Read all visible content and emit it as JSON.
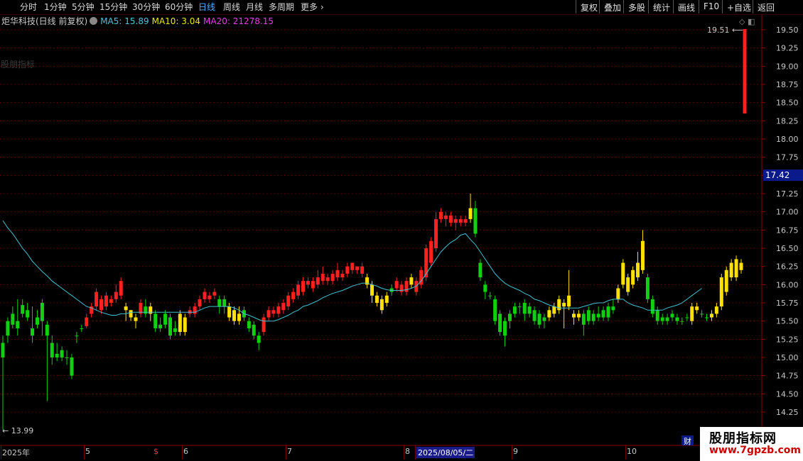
{
  "top_periods": [
    {
      "label": "分时",
      "active": false
    },
    {
      "label": "1分钟",
      "active": false
    },
    {
      "label": "5分钟",
      "active": false
    },
    {
      "label": "15分钟",
      "active": false
    },
    {
      "label": "30分钟",
      "active": false
    },
    {
      "label": "60分钟",
      "active": false
    },
    {
      "label": "日线",
      "active": true
    },
    {
      "label": "周线",
      "active": false
    },
    {
      "label": "月线",
      "active": false
    },
    {
      "label": "多周期",
      "active": false
    },
    {
      "label": "更多",
      "active": false
    }
  ],
  "right_buttons": [
    "复权",
    "叠加",
    "多股",
    "统计",
    "画线",
    "F10",
    "+自选",
    "返回"
  ],
  "stock_title": "炬华科技(日线 前复权)",
  "ma_labels": [
    {
      "text": "MA5: 15.89",
      "color": "#4fc3d8"
    },
    {
      "text": "MA10: 3.04",
      "color": "#e8e800"
    },
    {
      "text": "MA20: 21278.15",
      "color": "#e040e0"
    }
  ],
  "watermark_small": "股朋指标",
  "price_labels": [
    "19.50",
    "19.25",
    "19.00",
    "18.75",
    "18.50",
    "18.25",
    "18.00",
    "17.75",
    "17.50",
    "17.25",
    "17.00",
    "16.75",
    "16.50",
    "16.25",
    "16.00",
    "15.75",
    "15.50",
    "15.25",
    "15.00",
    "14.75",
    "14.50",
    "14.25"
  ],
  "current_price": "17.42",
  "high_marker": "19.51",
  "low_marker": "13.99",
  "bottom_labels": [
    {
      "text": "2025年",
      "color": "#c8c8c8"
    },
    {
      "text": "5",
      "color": "#c8c8c8"
    },
    {
      "text": "$",
      "color": "#ff3030"
    },
    {
      "text": "6",
      "color": "#c8c8c8"
    },
    {
      "text": "7",
      "color": "#c8c8c8"
    },
    {
      "text": "8",
      "color": "#c8c8c8"
    },
    {
      "text": "2025/08/05/二",
      "color": "#ffffff"
    },
    {
      "text": "9",
      "color": "#c8c8c8"
    },
    {
      "text": "10",
      "color": "#c8c8c8"
    }
  ],
  "cai_icon": "财",
  "site_watermark": {
    "line1": "股朋指标网",
    "line2": "www.7gpzb.com"
  },
  "colors": {
    "up": "#ff2020",
    "down": "#10d010",
    "yellow": "#ffe000",
    "ma": "#40c0d0",
    "grid": "#5a0000",
    "axis": "#8b0000"
  },
  "chart_data": {
    "type": "candlestick",
    "ylim": [
      13.9,
      19.6
    ],
    "candles": [
      [
        15.2,
        15.0,
        15.3,
        14.9,
        "g"
      ],
      [
        15.5,
        15.3,
        15.55,
        15.2,
        "g"
      ],
      [
        15.6,
        15.45,
        15.7,
        15.4,
        "g"
      ],
      [
        15.5,
        15.4,
        15.8,
        15.3,
        "g"
      ],
      [
        15.72,
        15.6,
        15.8,
        15.55,
        "g"
      ],
      [
        15.65,
        15.55,
        15.75,
        15.5,
        "g"
      ],
      [
        15.4,
        15.3,
        15.7,
        15.2,
        "g"
      ],
      [
        15.55,
        15.45,
        15.65,
        15.4,
        "g"
      ],
      [
        15.75,
        15.5,
        15.8,
        15.3,
        "g"
      ],
      [
        15.45,
        15.3,
        15.5,
        14.4,
        "g"
      ],
      [
        15.2,
        15.0,
        15.3,
        14.9,
        "g"
      ],
      [
        15.05,
        15.0,
        15.2,
        14.95,
        "g"
      ],
      [
        15.1,
        15.0,
        15.15,
        14.95,
        "g"
      ],
      [
        15.0,
        15.0,
        15.1,
        14.9,
        "g"
      ],
      [
        15.0,
        14.75,
        15.05,
        14.7,
        "g"
      ],
      [
        15.3,
        15.3,
        15.35,
        15.2,
        "g"
      ],
      [
        15.4,
        15.4,
        15.45,
        15.35,
        "g"
      ],
      [
        15.43,
        15.55,
        15.6,
        15.4,
        "r"
      ],
      [
        15.6,
        15.7,
        15.75,
        15.55,
        "r"
      ],
      [
        15.7,
        15.9,
        15.95,
        15.65,
        "r"
      ],
      [
        15.65,
        15.8,
        15.85,
        15.6,
        "r"
      ],
      [
        15.7,
        15.85,
        15.9,
        15.65,
        "r"
      ],
      [
        15.75,
        15.8,
        15.85,
        15.7,
        "r"
      ],
      [
        15.8,
        15.9,
        16.0,
        15.75,
        "r"
      ],
      [
        15.85,
        16.05,
        16.1,
        15.8,
        "r"
      ],
      [
        15.7,
        15.65,
        15.75,
        15.5,
        "y"
      ],
      [
        15.65,
        15.55,
        15.65,
        15.5,
        "y"
      ],
      [
        15.55,
        15.5,
        15.6,
        15.4,
        "y"
      ],
      [
        15.6,
        15.75,
        15.8,
        15.55,
        "r"
      ],
      [
        15.7,
        15.6,
        15.8,
        15.55,
        "g"
      ],
      [
        15.7,
        15.6,
        15.75,
        15.5,
        "y"
      ],
      [
        15.6,
        15.4,
        15.65,
        15.35,
        "g"
      ],
      [
        15.45,
        15.4,
        15.55,
        15.35,
        "g"
      ],
      [
        15.6,
        15.45,
        15.65,
        15.4,
        "g"
      ],
      [
        15.55,
        15.3,
        15.6,
        15.25,
        "g"
      ],
      [
        15.4,
        15.35,
        15.5,
        15.3,
        "g"
      ],
      [
        15.6,
        15.35,
        15.65,
        15.3,
        "y"
      ],
      [
        15.55,
        15.35,
        15.6,
        15.3,
        "y"
      ],
      [
        15.6,
        15.65,
        15.7,
        15.55,
        "r"
      ],
      [
        15.6,
        15.7,
        15.75,
        15.55,
        "r"
      ],
      [
        15.7,
        15.8,
        15.85,
        15.65,
        "r"
      ],
      [
        15.8,
        15.9,
        15.95,
        15.75,
        "r"
      ],
      [
        15.8,
        15.85,
        15.9,
        15.75,
        "r"
      ],
      [
        15.85,
        15.9,
        15.95,
        15.8,
        "r"
      ],
      [
        15.8,
        15.7,
        15.85,
        15.6,
        "g"
      ],
      [
        15.8,
        15.7,
        15.85,
        15.6,
        "g"
      ],
      [
        15.7,
        15.55,
        15.75,
        15.5,
        "y"
      ],
      [
        15.65,
        15.5,
        15.7,
        15.45,
        "y"
      ],
      [
        15.6,
        15.5,
        15.7,
        15.45,
        "y"
      ],
      [
        15.65,
        15.55,
        15.7,
        15.5,
        "g"
      ],
      [
        15.5,
        15.4,
        15.55,
        15.35,
        "g"
      ],
      [
        15.45,
        15.3,
        15.5,
        15.25,
        "g"
      ],
      [
        15.3,
        15.2,
        15.35,
        15.1,
        "g"
      ],
      [
        15.35,
        15.55,
        15.6,
        15.3,
        "r"
      ],
      [
        15.55,
        15.65,
        15.7,
        15.5,
        "r"
      ],
      [
        15.6,
        15.65,
        15.7,
        15.55,
        "r"
      ],
      [
        15.6,
        15.7,
        15.75,
        15.55,
        "r"
      ],
      [
        15.65,
        15.75,
        15.8,
        15.6,
        "r"
      ],
      [
        15.7,
        15.85,
        15.9,
        15.65,
        "r"
      ],
      [
        15.8,
        15.9,
        15.95,
        15.75,
        "r"
      ],
      [
        15.85,
        16.0,
        16.05,
        15.8,
        "r"
      ],
      [
        15.9,
        16.05,
        16.1,
        15.85,
        "r"
      ],
      [
        16.0,
        16.05,
        16.1,
        15.95,
        "r"
      ],
      [
        15.95,
        16.05,
        16.1,
        15.9,
        "r"
      ],
      [
        16.0,
        16.1,
        16.2,
        15.95,
        "r"
      ],
      [
        16.05,
        16.15,
        16.25,
        16.0,
        "r"
      ],
      [
        16.05,
        16.1,
        16.15,
        16.0,
        "r"
      ],
      [
        16.05,
        16.15,
        16.2,
        16.0,
        "r"
      ],
      [
        16.1,
        16.2,
        16.3,
        16.05,
        "r"
      ],
      [
        16.1,
        16.15,
        16.2,
        16.05,
        "r"
      ],
      [
        16.15,
        16.25,
        16.3,
        16.1,
        "r"
      ],
      [
        16.2,
        16.3,
        16.3,
        16.15,
        "r"
      ],
      [
        16.25,
        16.2,
        16.25,
        16.15,
        "r"
      ],
      [
        16.15,
        16.25,
        16.3,
        16.1,
        "r"
      ],
      [
        16.1,
        16.0,
        16.15,
        15.95,
        "y"
      ],
      [
        16.0,
        15.85,
        16.05,
        15.75,
        "y"
      ],
      [
        15.85,
        15.75,
        15.9,
        15.7,
        "y"
      ],
      [
        15.8,
        15.65,
        15.85,
        15.6,
        "y"
      ],
      [
        15.75,
        15.85,
        15.9,
        15.7,
        "y"
      ],
      [
        15.9,
        15.95,
        16.0,
        15.85,
        "g"
      ],
      [
        15.95,
        16.05,
        16.1,
        15.9,
        "r"
      ],
      [
        16.0,
        15.9,
        16.05,
        15.85,
        "r"
      ],
      [
        15.9,
        16.05,
        16.1,
        15.85,
        "r"
      ],
      [
        16.0,
        16.1,
        16.15,
        15.95,
        "y"
      ],
      [
        16.05,
        15.9,
        16.1,
        15.85,
        "r"
      ],
      [
        16.0,
        16.2,
        16.25,
        15.95,
        "r"
      ],
      [
        16.1,
        16.5,
        16.55,
        16.05,
        "r"
      ],
      [
        16.3,
        16.6,
        16.65,
        16.25,
        "r"
      ],
      [
        16.5,
        16.9,
        17.0,
        16.45,
        "r"
      ],
      [
        16.9,
        17.0,
        17.05,
        16.85,
        "r"
      ],
      [
        16.95,
        16.9,
        17.0,
        16.8,
        "r"
      ],
      [
        16.85,
        16.95,
        17.0,
        16.8,
        "r"
      ],
      [
        16.9,
        16.85,
        16.95,
        16.75,
        "r"
      ],
      [
        16.85,
        16.9,
        16.95,
        16.8,
        "r"
      ],
      [
        16.9,
        16.85,
        16.95,
        16.8,
        "r"
      ],
      [
        16.9,
        17.05,
        17.25,
        16.85,
        "y"
      ],
      [
        17.05,
        16.7,
        17.15,
        16.65,
        "g"
      ],
      [
        16.3,
        16.1,
        16.35,
        16.05,
        "g"
      ],
      [
        16.0,
        15.9,
        16.05,
        15.8,
        "g"
      ],
      [
        15.85,
        15.85,
        15.9,
        15.8,
        "g"
      ],
      [
        15.8,
        15.5,
        15.85,
        15.45,
        "g"
      ],
      [
        15.6,
        15.35,
        15.65,
        15.3,
        "g"
      ],
      [
        15.5,
        15.3,
        15.55,
        15.15,
        "g"
      ],
      [
        15.6,
        15.5,
        15.65,
        15.4,
        "g"
      ],
      [
        15.6,
        15.7,
        15.75,
        15.55,
        "g"
      ],
      [
        15.7,
        15.7,
        15.75,
        15.6,
        "g"
      ],
      [
        15.75,
        15.6,
        15.8,
        15.5,
        "g"
      ],
      [
        15.7,
        15.6,
        15.75,
        15.55,
        "g"
      ],
      [
        15.65,
        15.5,
        15.7,
        15.45,
        "g"
      ],
      [
        15.6,
        15.45,
        15.65,
        15.4,
        "g"
      ],
      [
        15.55,
        15.5,
        15.6,
        15.4,
        "g"
      ],
      [
        15.55,
        15.65,
        15.7,
        15.5,
        "y"
      ],
      [
        15.7,
        15.6,
        15.75,
        15.55,
        "y"
      ],
      [
        15.65,
        15.8,
        15.85,
        15.6,
        "y"
      ],
      [
        15.75,
        15.7,
        15.8,
        15.4,
        "y"
      ],
      [
        15.7,
        15.85,
        16.2,
        15.65,
        "y"
      ],
      [
        15.6,
        15.55,
        15.65,
        15.45,
        "y"
      ],
      [
        15.55,
        15.6,
        15.65,
        15.5,
        "y"
      ],
      [
        15.6,
        15.45,
        15.65,
        15.3,
        "g"
      ],
      [
        15.5,
        15.65,
        15.7,
        15.45,
        "g"
      ],
      [
        15.6,
        15.5,
        15.65,
        15.45,
        "g"
      ],
      [
        15.55,
        15.6,
        15.7,
        15.5,
        "g"
      ],
      [
        15.65,
        15.55,
        15.7,
        15.5,
        "g"
      ],
      [
        15.55,
        15.7,
        15.75,
        15.5,
        "g"
      ],
      [
        15.7,
        15.65,
        15.8,
        15.6,
        "g"
      ],
      [
        15.8,
        15.95,
        16.0,
        15.75,
        "y"
      ],
      [
        16.0,
        16.3,
        16.35,
        15.95,
        "y"
      ],
      [
        15.9,
        16.1,
        16.15,
        15.85,
        "y"
      ],
      [
        16.0,
        16.2,
        16.25,
        15.95,
        "y"
      ],
      [
        16.1,
        16.3,
        16.45,
        16.05,
        "y"
      ],
      [
        16.2,
        16.6,
        16.75,
        16.15,
        "y"
      ],
      [
        16.1,
        15.8,
        16.15,
        15.75,
        "g"
      ],
      [
        15.8,
        15.6,
        15.85,
        15.55,
        "g"
      ],
      [
        15.65,
        15.5,
        15.7,
        15.45,
        "g"
      ],
      [
        15.5,
        15.55,
        15.6,
        15.45,
        "g"
      ],
      [
        15.55,
        15.5,
        15.6,
        15.45,
        "g"
      ],
      [
        15.55,
        15.6,
        15.65,
        15.5,
        "g"
      ],
      [
        15.55,
        15.5,
        15.6,
        15.45,
        "g"
      ],
      [
        15.5,
        15.5,
        15.55,
        15.45,
        "g"
      ],
      [
        15.55,
        15.55,
        15.6,
        15.5,
        "g"
      ],
      [
        15.5,
        15.7,
        15.75,
        15.45,
        "y"
      ],
      [
        15.7,
        15.65,
        15.75,
        15.6,
        "y"
      ],
      [
        15.6,
        15.6,
        15.65,
        15.55,
        "g"
      ],
      [
        15.55,
        15.55,
        15.6,
        15.5,
        "g"
      ],
      [
        15.55,
        15.6,
        15.65,
        15.5,
        "y"
      ],
      [
        15.6,
        15.7,
        15.75,
        15.55,
        "y"
      ],
      [
        15.7,
        16.1,
        16.15,
        15.65,
        "y"
      ],
      [
        15.9,
        16.2,
        16.25,
        15.85,
        "y"
      ],
      [
        16.1,
        16.3,
        16.35,
        16.05,
        "y"
      ],
      [
        16.1,
        16.35,
        16.4,
        16.05,
        "y"
      ],
      [
        16.2,
        16.3,
        16.35,
        16.15,
        "y"
      ]
    ],
    "ma": [
      16.88,
      16.78,
      16.7,
      16.6,
      16.5,
      16.42,
      16.32,
      16.25,
      16.18,
      16.12,
      16.05,
      16.0,
      15.95,
      15.9,
      15.85,
      15.8,
      15.75,
      15.7,
      15.68,
      15.65,
      15.62,
      15.6,
      15.58,
      15.58,
      15.6,
      15.6,
      15.62,
      15.62,
      15.62,
      15.62,
      15.62,
      15.62,
      15.62,
      15.62,
      15.62,
      15.62,
      15.62,
      15.62,
      15.62,
      15.62,
      15.65,
      15.68,
      15.7,
      15.7,
      15.7,
      15.7,
      15.7,
      15.68,
      15.65,
      15.6,
      15.58,
      15.55,
      15.52,
      15.5,
      15.5,
      15.5,
      15.52,
      15.55,
      15.58,
      15.62,
      15.65,
      15.7,
      15.72,
      15.75,
      15.78,
      15.82,
      15.85,
      15.88,
      15.9,
      15.92,
      15.95,
      15.98,
      16.0,
      16.02,
      16.02,
      16.0,
      15.98,
      15.95,
      15.93,
      15.92,
      15.92,
      15.92,
      15.93,
      15.95,
      15.98,
      16.05,
      16.15,
      16.25,
      16.35,
      16.45,
      16.52,
      16.58,
      16.62,
      16.68,
      16.7,
      16.62,
      16.55,
      16.45,
      16.35,
      16.25,
      16.15,
      16.08,
      16.02,
      15.98,
      15.95,
      15.92,
      15.88,
      15.85,
      15.8,
      15.78,
      15.75,
      15.72,
      15.7,
      15.68,
      15.68,
      15.68,
      15.68,
      15.68,
      15.7,
      15.72,
      15.74,
      15.75,
      15.75,
      15.78,
      15.8,
      15.8,
      15.8,
      15.75,
      15.72,
      15.7,
      15.68,
      15.65,
      15.65,
      15.65,
      15.65,
      15.68,
      15.7,
      15.72,
      15.75,
      15.8,
      15.85,
      15.9,
      15.95
    ],
    "high_bar": [
      18.35,
      19.51
    ]
  }
}
